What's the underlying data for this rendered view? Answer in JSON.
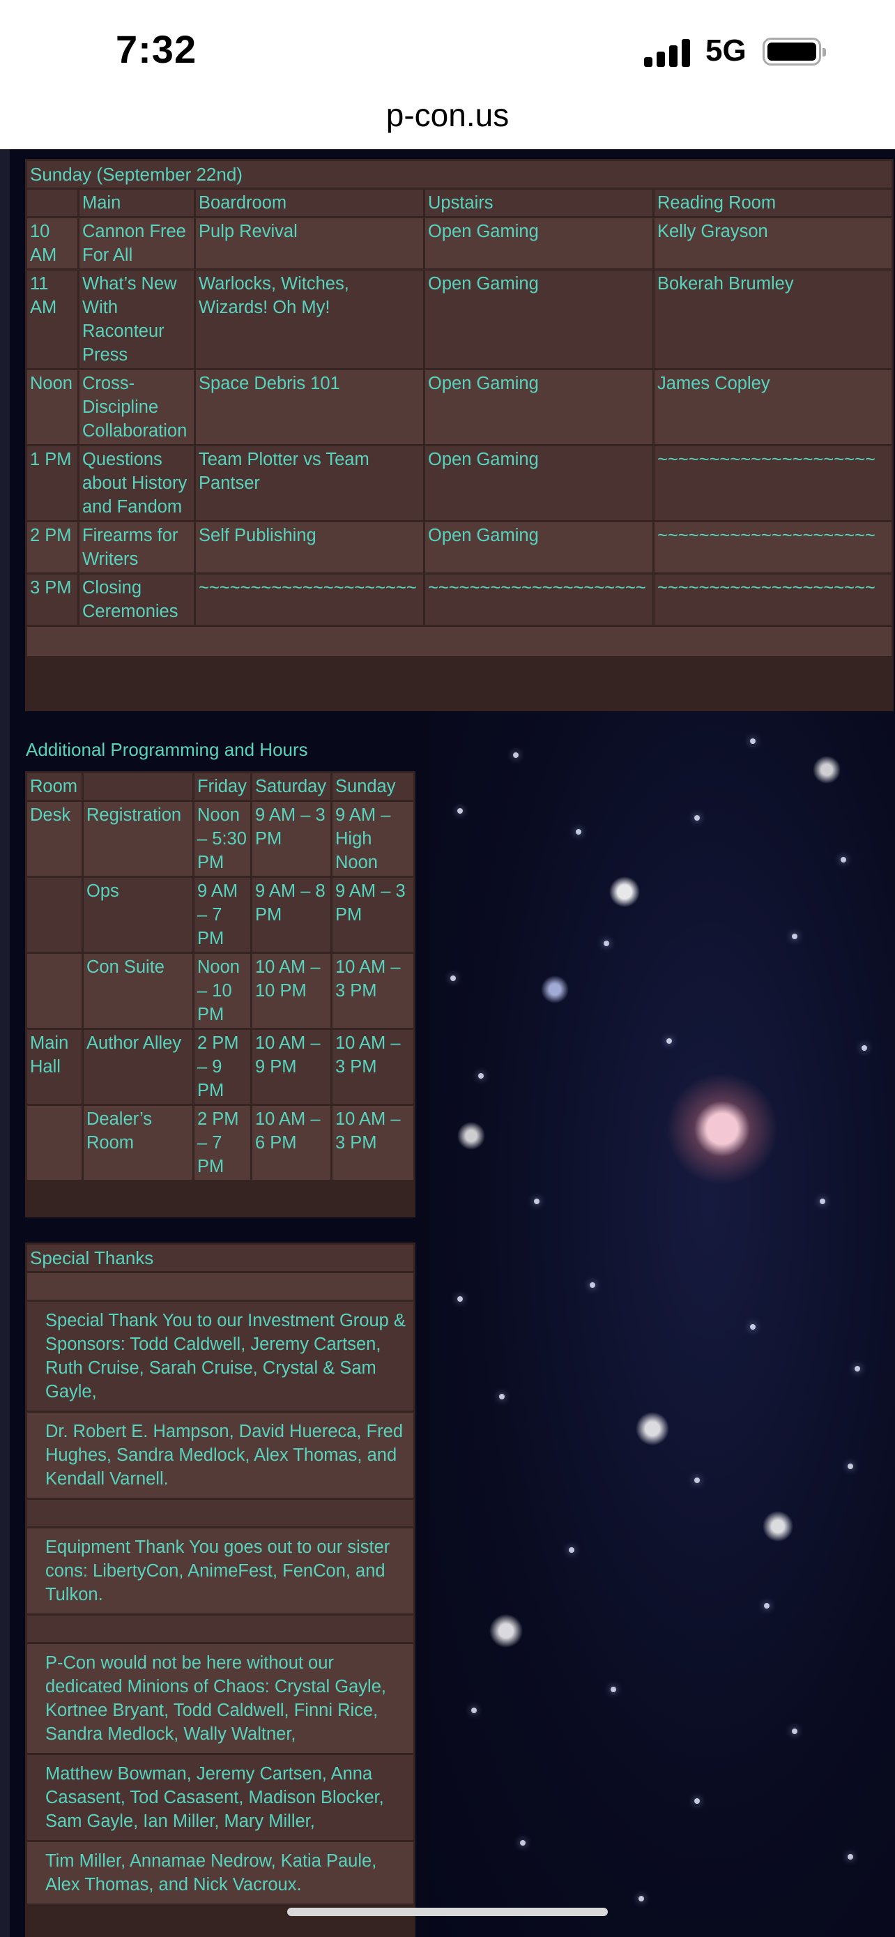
{
  "status": {
    "time": "7:32",
    "network": "5G"
  },
  "browser": {
    "url": "p-con.us"
  },
  "sunday": {
    "title": "Sunday (September 22nd)",
    "headers": [
      "",
      "Main",
      "Boardroom",
      "Upstairs",
      "Reading Room"
    ],
    "rows": [
      [
        "10 AM",
        "Cannon Free For All",
        "Pulp Revival",
        "Open Gaming",
        "Kelly Grayson"
      ],
      [
        "11 AM",
        "What’s New With Raconteur Press",
        "Warlocks, Witches, Wizards! Oh My!",
        "Open Gaming",
        "Bokerah Brumley"
      ],
      [
        "Noon",
        "Cross-Discipline Collaboration",
        "Space Debris 101",
        "Open Gaming",
        "James Copley"
      ],
      [
        "1 PM",
        "Questions about History and Fandom",
        "Team Plotter vs Team Pantser",
        "Open Gaming",
        "~~~~~~~~~~~~~~~~~~~~~"
      ],
      [
        "2 PM",
        "Firearms for Writers",
        "Self Publishing",
        "Open Gaming",
        "~~~~~~~~~~~~~~~~~~~~~"
      ],
      [
        "3 PM",
        "Closing Ceremonies",
        "~~~~~~~~~~~~~~~~~~~~~",
        "~~~~~~~~~~~~~~~~~~~~~",
        "~~~~~~~~~~~~~~~~~~~~~"
      ]
    ]
  },
  "additional": {
    "title": "Additional Programming and Hours",
    "headers": [
      "Room",
      "",
      "Friday",
      "Saturday",
      "Sunday"
    ],
    "rows": [
      [
        "Desk",
        "Registration",
        "Noon – 5:30 PM",
        "9 AM – 3 PM",
        "9 AM – High Noon"
      ],
      [
        "",
        "Ops",
        "9 AM – 7 PM",
        "9 AM – 8 PM",
        "9 AM – 3 PM"
      ],
      [
        "",
        "Con Suite",
        "Noon – 10 PM",
        "10 AM – 10 PM",
        "10 AM – 3 PM"
      ],
      [
        "Main Hall",
        "Author Alley",
        "2 PM – 9 PM",
        "10 AM – 9 PM",
        "10 AM – 3 PM"
      ],
      [
        "",
        "Dealer’s Room",
        "2 PM – 7 PM",
        "10 AM – 6 PM",
        "10 AM – 3 PM"
      ]
    ]
  },
  "thanks": {
    "title": "Special Thanks",
    "p1": "Special Thank You to our Investment Group & Sponsors: Todd Caldwell, Jeremy Cartsen, Ruth Cruise, Sarah Cruise, Crystal & Sam Gayle,",
    "p2": " Dr. Robert E. Hampson, David Huereca, Fred Hughes, Sandra Medlock, Alex Thomas, and Kendall Varnell.",
    "p3": "Equipment Thank You goes out to our sister cons:  LibertyCon, AnimeFest, FenCon, and Tulkon.",
    "p4": "P-Con would not be here without our dedicated Minions of Chaos:  Crystal Gayle, Kortnee Bryant, Todd Caldwell, Finni Rice, Sandra Medlock, Wally Waltner,",
    "p5": "Matthew Bowman, Jeremy Cartsen, Anna Casasent, Tod Casasent, Madison Blocker, Sam Gayle, Ian Miller, Mary Miller,",
    "p6": "Tim Miller, Annamae Nedrow, Katia Paule, Alex Thomas, and Nick Vacroux."
  },
  "colors": {
    "text": "#58d3be",
    "cell": "#4a3330",
    "cell_alt": "#543b37",
    "frame": "#352421"
  }
}
